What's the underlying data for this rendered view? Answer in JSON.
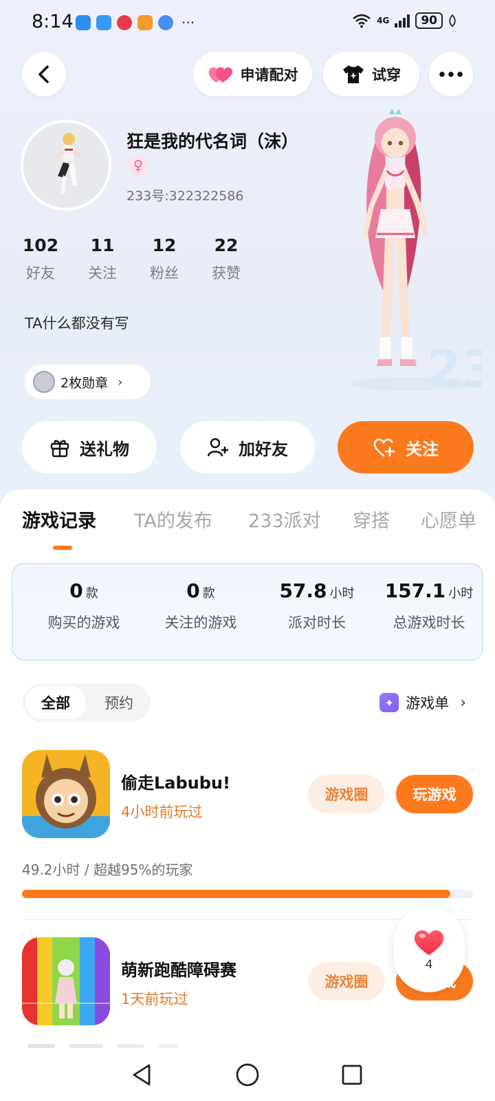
{
  "status_bar": {
    "time": "8:14",
    "more": "···",
    "network": "4G",
    "battery": "90"
  },
  "header": {
    "pair_label": "申请配对",
    "try_label": "试穿"
  },
  "profile": {
    "nickname": "狂是我的代名词（沫）",
    "gender_symbol": "♀",
    "uid": "233号:322322586",
    "stats": [
      {
        "value": "102",
        "label": "好友"
      },
      {
        "value": "11",
        "label": "关注"
      },
      {
        "value": "12",
        "label": "粉丝"
      },
      {
        "value": "22",
        "label": "获赞"
      }
    ],
    "bio": "TA什么都没有写",
    "medals": "2枚勋章"
  },
  "actions": {
    "gift": "送礼物",
    "add_friend": "加好友",
    "follow": "关注"
  },
  "tabs": [
    "游戏记录",
    "TA的发布",
    "233派对",
    "穿搭",
    "心愿单"
  ],
  "summary": [
    {
      "value": "0",
      "unit": "款",
      "label": "购买的游戏"
    },
    {
      "value": "0",
      "unit": "款",
      "label": "关注的游戏"
    },
    {
      "value": "57.8",
      "unit": "小时",
      "label": "派对时长"
    },
    {
      "value": "157.1",
      "unit": "小时",
      "label": "总游戏时长"
    }
  ],
  "filter": {
    "all": "全部",
    "reserve": "预约"
  },
  "game_list_link": "游戏单",
  "games": [
    {
      "name": "偷走Labubu!",
      "last_played": "4小时前玩过",
      "circle": "游戏圈",
      "play": "玩游戏"
    },
    {
      "name": "萌新跑酷障碍赛",
      "last_played": "1天前玩过",
      "circle": "游戏圈",
      "play": "玩游戏"
    }
  ],
  "first_game_stats": {
    "text": "49.2小时 / 超越95%的玩家",
    "progress": 0.95
  },
  "like": {
    "count": "4"
  },
  "colors": {
    "accent": "#fb7a1e",
    "accent_soft": "#fdeee4",
    "time_text": "#e07b28"
  }
}
